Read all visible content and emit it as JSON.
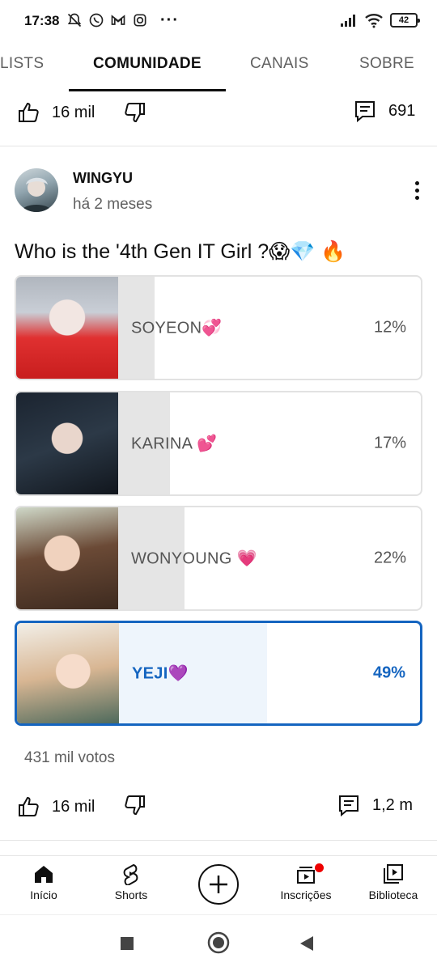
{
  "status_bar": {
    "time": "17:38",
    "battery": "42",
    "icons": [
      "mute-icon",
      "whatsapp-icon",
      "gmail-icon",
      "instagram-icon",
      "more-dots"
    ],
    "right_icons": [
      "signal-icon",
      "wifi-icon",
      "battery-icon"
    ],
    "more": "···"
  },
  "tabs": [
    {
      "label": "LISTS"
    },
    {
      "label": "COMUNIDADE",
      "active": true
    },
    {
      "label": "CANAIS"
    },
    {
      "label": "SOBRE"
    }
  ],
  "prev_post_actions": {
    "likes": "16 mil",
    "comments": "691"
  },
  "post": {
    "author": "WINGYU",
    "time_ago": "há 2 meses",
    "question": "Who is the '4th Gen IT Girl ?😱💎 🔥",
    "poll": [
      {
        "label": "SOYEON💞",
        "percent_text": "12%",
        "percent": 12,
        "selected": false
      },
      {
        "label": "KARINA 💕",
        "percent_text": "17%",
        "percent": 17,
        "selected": false
      },
      {
        "label": "WONYOUNG 💗",
        "percent_text": "22%",
        "percent": 22,
        "selected": false
      },
      {
        "label": "YEJI💜",
        "percent_text": "49%",
        "percent": 49,
        "selected": true
      }
    ],
    "votes": "431 mil votos",
    "likes": "16 mil",
    "comments": "1,2 m"
  },
  "bottom_nav": [
    {
      "label": "Início",
      "icon": "home-icon"
    },
    {
      "label": "Shorts",
      "icon": "shorts-icon"
    },
    {
      "label": "",
      "icon": "create-icon"
    },
    {
      "label": "Inscrições",
      "icon": "subscriptions-icon"
    },
    {
      "label": "Biblioteca",
      "icon": "library-icon"
    }
  ],
  "colors": {
    "accent": "#1565c0",
    "poll_fill": "#e5e5e5",
    "selected_fill": "#eef5fc",
    "notification": "#ee0000"
  }
}
